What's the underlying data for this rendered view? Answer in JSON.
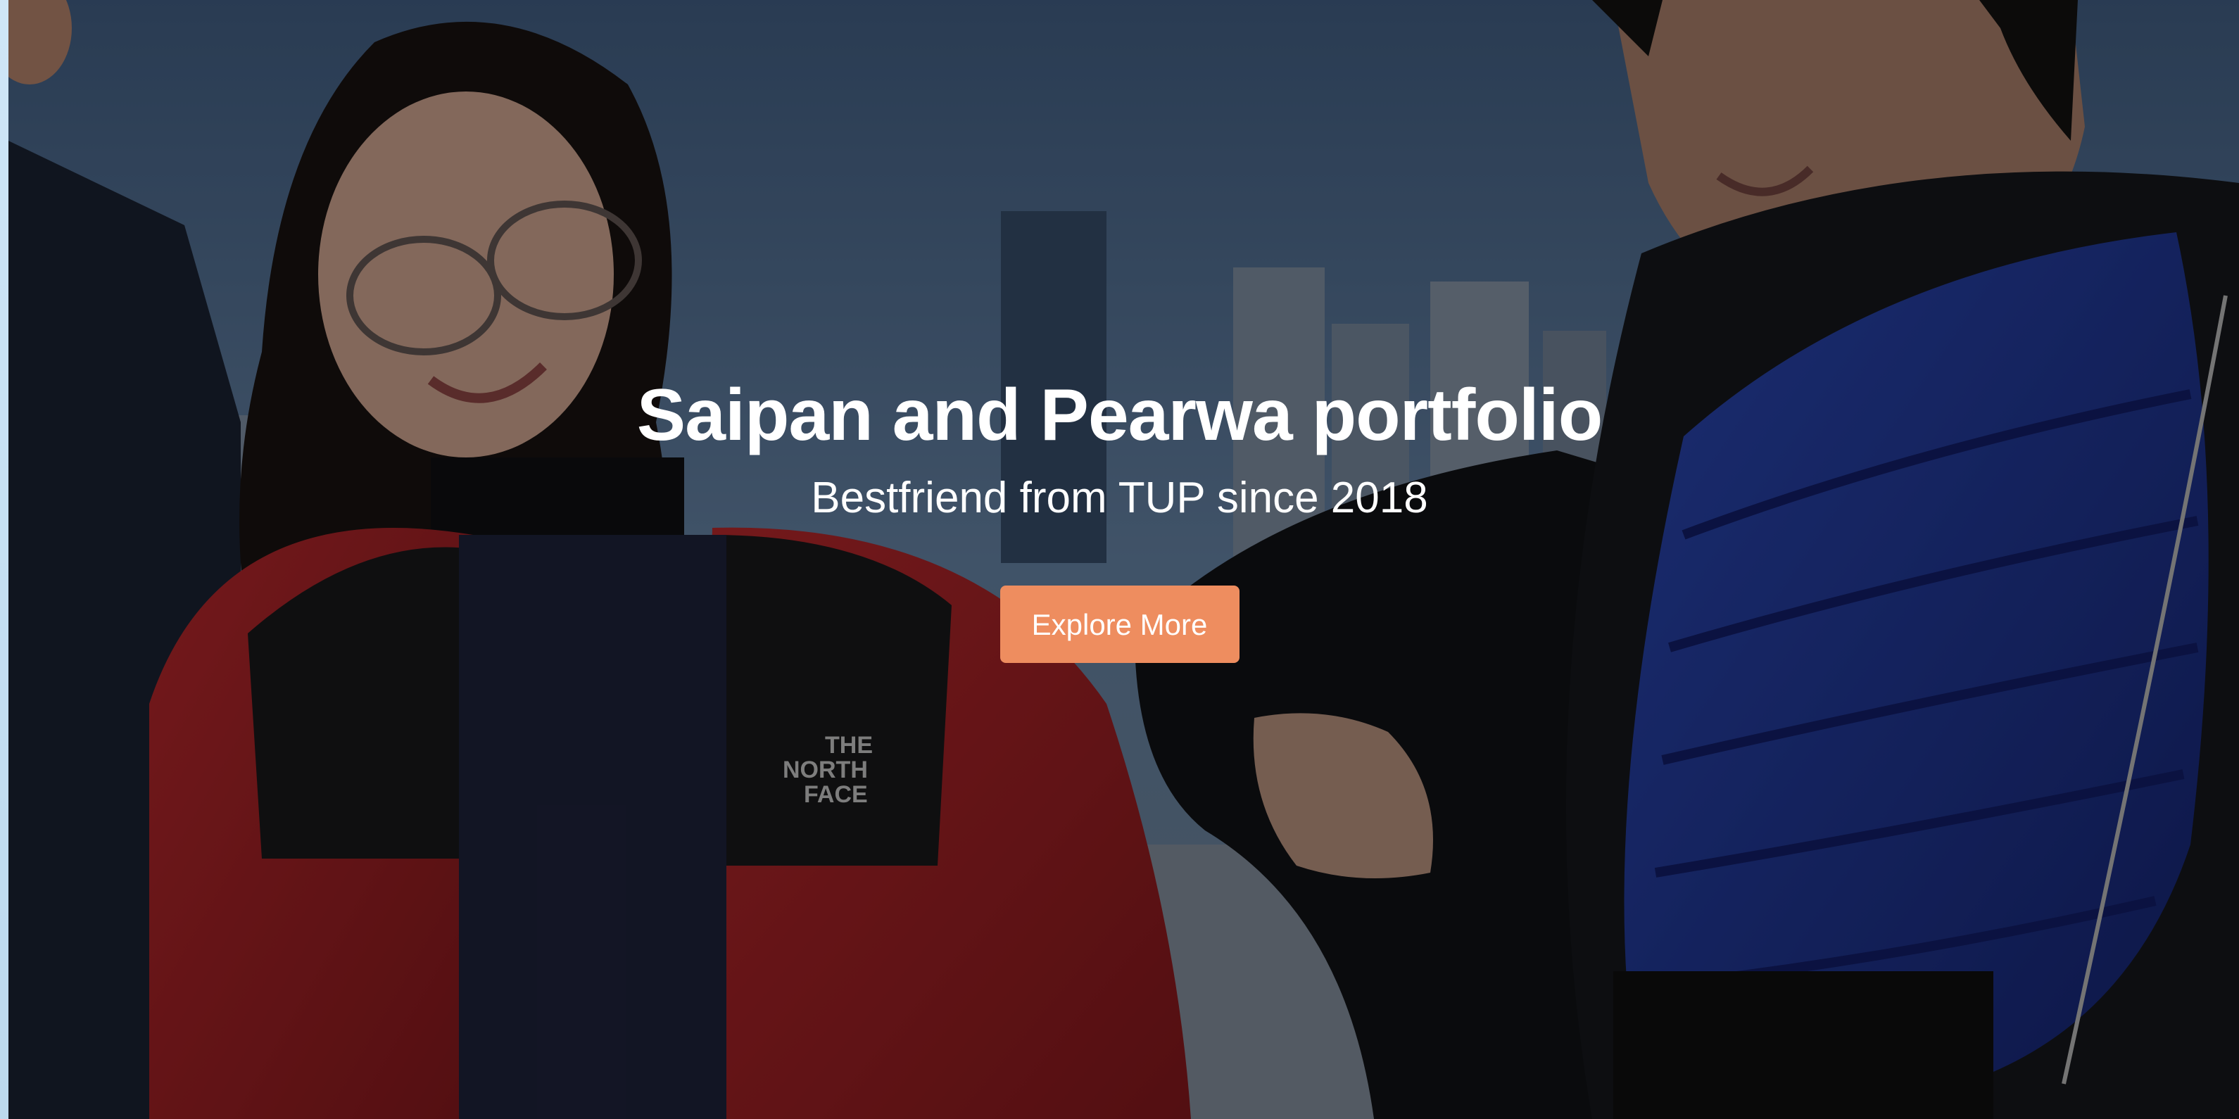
{
  "hero": {
    "title": "Saipan and Pearwa portfolio",
    "subtitle": "Bestfriend from TUP since 2018",
    "cta_label": "Explore More",
    "jacket_logo_text": "THE NORTH FACE"
  },
  "colors": {
    "cta_background": "#ee8d5f",
    "text": "#ffffff",
    "overlay": "rgba(0,0,0,0.42)",
    "sky": "#5c7ba0",
    "red_jacket": "#b8262c",
    "blue_jacket": "#2440a8"
  }
}
